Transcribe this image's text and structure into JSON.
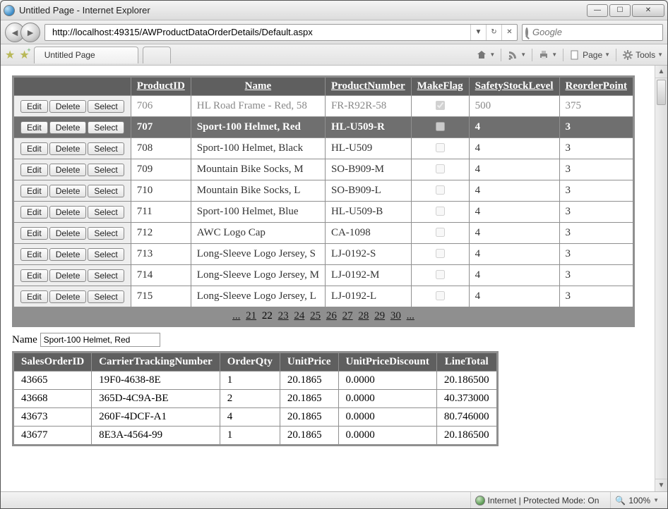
{
  "window": {
    "title": "Untitled Page - Internet Explorer"
  },
  "nav": {
    "url": "http://localhost:49315/AWProductDataOrderDetails/Default.aspx",
    "search_placeholder": "Google"
  },
  "tab": {
    "title": "Untitled Page"
  },
  "cmdbar": {
    "page_label": "Page",
    "tools_label": "Tools"
  },
  "grid": {
    "headers": {
      "productid": "ProductID",
      "name": "Name",
      "productnumber": "ProductNumber",
      "makeflag": "MakeFlag",
      "safetystocklevel": "SafetyStockLevel",
      "reorderpoint": "ReorderPoint"
    },
    "buttons": {
      "edit": "Edit",
      "delete": "Delete",
      "select": "Select"
    },
    "rows": [
      {
        "id": "706",
        "name": "HL Road Frame - Red, 58",
        "pn": "FR-R92R-58",
        "make": true,
        "ssl": "500",
        "rp": "375",
        "selected": false,
        "muted": true
      },
      {
        "id": "707",
        "name": "Sport-100 Helmet, Red",
        "pn": "HL-U509-R",
        "make": false,
        "ssl": "4",
        "rp": "3",
        "selected": true
      },
      {
        "id": "708",
        "name": "Sport-100 Helmet, Black",
        "pn": "HL-U509",
        "make": false,
        "ssl": "4",
        "rp": "3"
      },
      {
        "id": "709",
        "name": "Mountain Bike Socks, M",
        "pn": "SO-B909-M",
        "make": false,
        "ssl": "4",
        "rp": "3"
      },
      {
        "id": "710",
        "name": "Mountain Bike Socks, L",
        "pn": "SO-B909-L",
        "make": false,
        "ssl": "4",
        "rp": "3"
      },
      {
        "id": "711",
        "name": "Sport-100 Helmet, Blue",
        "pn": "HL-U509-B",
        "make": false,
        "ssl": "4",
        "rp": "3"
      },
      {
        "id": "712",
        "name": "AWC Logo Cap",
        "pn": "CA-1098",
        "make": false,
        "ssl": "4",
        "rp": "3"
      },
      {
        "id": "713",
        "name": "Long-Sleeve Logo Jersey, S",
        "pn": "LJ-0192-S",
        "make": false,
        "ssl": "4",
        "rp": "3"
      },
      {
        "id": "714",
        "name": "Long-Sleeve Logo Jersey, M",
        "pn": "LJ-0192-M",
        "make": false,
        "ssl": "4",
        "rp": "3"
      },
      {
        "id": "715",
        "name": "Long-Sleeve Logo Jersey, L",
        "pn": "LJ-0192-L",
        "make": false,
        "ssl": "4",
        "rp": "3"
      }
    ],
    "pager": {
      "prefix": "...",
      "pages": [
        "21",
        "22",
        "23",
        "24",
        "25",
        "26",
        "27",
        "28",
        "29",
        "30"
      ],
      "current": "22",
      "suffix": "..."
    }
  },
  "namefield": {
    "label": "Name",
    "value": "Sport-100 Helmet, Red"
  },
  "details": {
    "headers": {
      "soid": "SalesOrderID",
      "ctn": "CarrierTrackingNumber",
      "qty": "OrderQty",
      "price": "UnitPrice",
      "disc": "UnitPriceDiscount",
      "total": "LineTotal"
    },
    "rows": [
      {
        "soid": "43665",
        "ctn": "19F0-4638-8E",
        "qty": "1",
        "price": "20.1865",
        "disc": "0.0000",
        "total": "20.186500"
      },
      {
        "soid": "43668",
        "ctn": "365D-4C9A-BE",
        "qty": "2",
        "price": "20.1865",
        "disc": "0.0000",
        "total": "40.373000"
      },
      {
        "soid": "43673",
        "ctn": "260F-4DCF-A1",
        "qty": "4",
        "price": "20.1865",
        "disc": "0.0000",
        "total": "80.746000"
      },
      {
        "soid": "43677",
        "ctn": "8E3A-4564-99",
        "qty": "1",
        "price": "20.1865",
        "disc": "0.0000",
        "total": "20.186500"
      }
    ]
  },
  "status": {
    "zone": "Internet | Protected Mode: On",
    "zoom": "100%"
  }
}
